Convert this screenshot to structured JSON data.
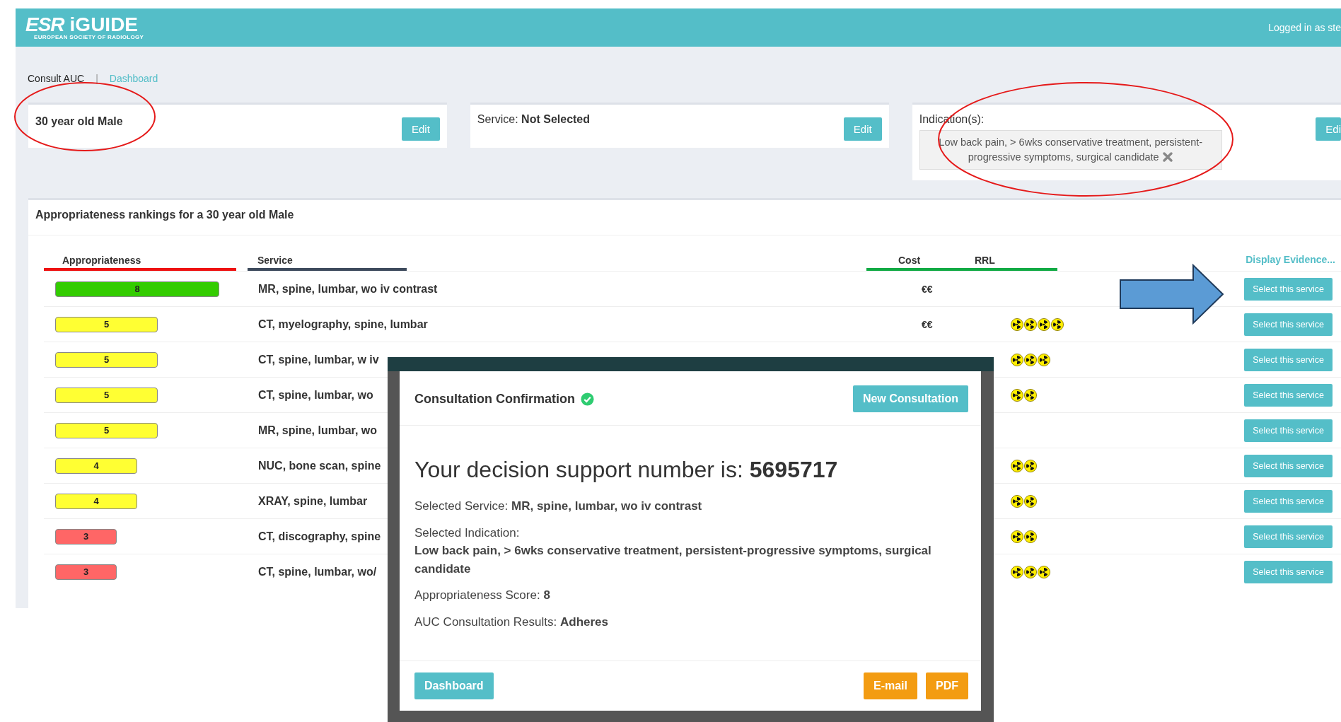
{
  "header": {
    "logo_mark": "ESR",
    "logo_name": "iGUIDE",
    "logo_subtitle": "EUROPEAN SOCIETY OF RADIOLOGY",
    "user_text": "Logged in as ste"
  },
  "breadcrumb": {
    "current": "Consult AUC",
    "separator": "|",
    "link": "Dashboard"
  },
  "cards": [
    {
      "kind": "patient",
      "text": "30 year old Male",
      "button": "Edit"
    },
    {
      "kind": "service",
      "label": "Service:",
      "value": "Not Selected",
      "button": "Edit"
    },
    {
      "kind": "indication",
      "label": "Indication(s):",
      "tag": "Low back pain, > 6wks conservative treatment, persistent-progressive symptoms, surgical candidate",
      "button": "Edi"
    }
  ],
  "rankings": {
    "title": "Appropriateness rankings for a 30 year old Male",
    "columns": {
      "appropriateness": "Appropriateness",
      "service": "Service",
      "cost": "Cost",
      "rrl": "RRL",
      "evidence": "Display Evidence..."
    },
    "rows": [
      {
        "score": "8",
        "color": "#33cc00",
        "service": "MR, spine, lumbar, wo iv contrast",
        "cost": "€€",
        "button": "Select this service"
      },
      {
        "score": "5",
        "color": "#ffff33",
        "service": "CT, myelography, spine, lumbar",
        "cost": "€€",
        "rrl_icons": [
          {
            "kind": "radiation"
          },
          {
            "kind": "radiation"
          },
          {
            "kind": "radiation"
          },
          {
            "kind": "radiation"
          }
        ],
        "button": "Select this service"
      },
      {
        "score": "5",
        "color": "#ffff33",
        "service": "CT, spine, lumbar, w iv",
        "rrl_icons": [
          {
            "kind": "radiation"
          },
          {
            "kind": "radiation"
          },
          {
            "kind": "radiation"
          }
        ],
        "button": "Select this service"
      },
      {
        "score": "5",
        "color": "#ffff33",
        "service": "CT, spine, lumbar, wo",
        "rrl_icons": [
          {
            "kind": "radiation"
          },
          {
            "kind": "radiation"
          }
        ],
        "button": "Select this service"
      },
      {
        "score": "5",
        "color": "#ffff33",
        "service": "MR, spine, lumbar, wo",
        "button": "Select this service"
      },
      {
        "score": "4",
        "color": "#ffff33",
        "service": "NUC, bone scan, spine",
        "rrl_icons": [
          {
            "kind": "radiation"
          },
          {
            "kind": "radiation"
          }
        ],
        "button": "Select this service"
      },
      {
        "score": "4",
        "color": "#ffff33",
        "service": "XRAY, spine, lumbar",
        "rrl_icons": [
          {
            "kind": "radiation"
          },
          {
            "kind": "radiation"
          }
        ],
        "button": "Select this service"
      },
      {
        "score": "3",
        "color": "#ff6666",
        "service": "CT, discography, spine",
        "rrl_icons": [
          {
            "kind": "radiation"
          },
          {
            "kind": "radiation"
          }
        ],
        "button": "Select this service"
      },
      {
        "score": "3",
        "color": "#ff6666",
        "service": "CT, spine, lumbar, wo/",
        "rrl_icons": [
          {
            "kind": "radiation"
          },
          {
            "kind": "radiation"
          },
          {
            "kind": "radiation"
          }
        ],
        "button": "Select this service"
      }
    ]
  },
  "modal": {
    "title": "Consultation Confirmation",
    "new_button": "New Consultation",
    "heading": "Your decision support number is:",
    "number": "5695717",
    "fields": [
      {
        "kind": "inline",
        "label": "Selected Service:",
        "value": "MR, spine, lumbar, wo iv contrast"
      },
      {
        "kind": "block",
        "label": "Selected Indication:",
        "value": "Low back pain, > 6wks conservative treatment, persistent-progressive symptoms, surgical candidate"
      },
      {
        "kind": "inline",
        "label": "Appropriateness Score:",
        "value": "8"
      },
      {
        "kind": "inline",
        "label": "AUC Consultation Results:",
        "value": "Adheres"
      }
    ],
    "buttons": [
      {
        "kind": "primary",
        "label": "Dashboard"
      },
      {
        "kind": "warning",
        "label": "E-mail"
      },
      {
        "kind": "warning",
        "label": "PDF"
      }
    ]
  }
}
